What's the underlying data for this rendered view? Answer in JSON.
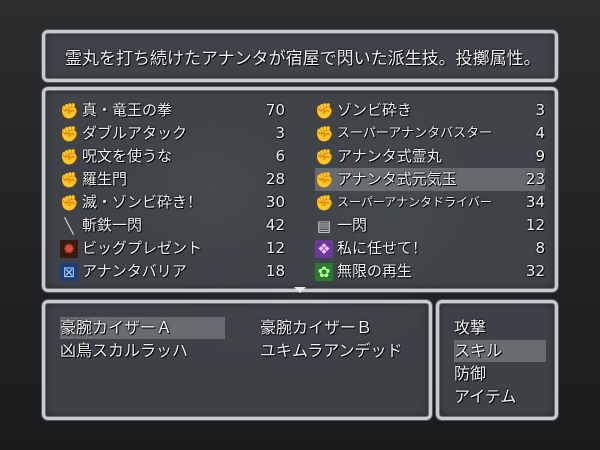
{
  "help": {
    "text": "霊丸を打ち続けたアナンタが宿屋で閃いた派生技。投擲属性。"
  },
  "skills": {
    "left": [
      {
        "icon": "fist-icon",
        "name": "真・竜王の拳",
        "cost": "70"
      },
      {
        "icon": "fist-icon",
        "name": "ダブルアタック",
        "cost": "3"
      },
      {
        "icon": "fist-icon",
        "name": "呪文を使うな",
        "cost": "6"
      },
      {
        "icon": "fist-icon",
        "name": "羅生門",
        "cost": "28"
      },
      {
        "icon": "fist-icon",
        "name": "滅・ゾンビ砕き！",
        "cost": "30"
      },
      {
        "icon": "sword-icon",
        "name": "斬鉄一閃",
        "cost": "42"
      },
      {
        "icon": "present-icon",
        "name": "ビッグプレゼント",
        "cost": "12"
      },
      {
        "icon": "barrier-icon",
        "name": "アナンタバリア",
        "cost": "18"
      }
    ],
    "right": [
      {
        "icon": "fist-icon",
        "name": "ゾンビ砕き",
        "cost": "3"
      },
      {
        "icon": "fist-icon",
        "name": "スーパーアナンタバスター",
        "cost": "4"
      },
      {
        "icon": "fist-icon",
        "name": "アナンタ式霊丸",
        "cost": "9"
      },
      {
        "icon": "fist-icon",
        "name": "アナンタ式元気玉",
        "cost": "23"
      },
      {
        "icon": "fist-icon",
        "name": "スーパーアナンタドライバー",
        "cost": "34"
      },
      {
        "icon": "sword-scroll-icon",
        "name": "一閃",
        "cost": "12"
      },
      {
        "icon": "purple-rune-icon",
        "name": "私に任せて！",
        "cost": "8"
      },
      {
        "icon": "green-regen-icon",
        "name": "無限の再生",
        "cost": "32"
      }
    ],
    "selected": "アナンタ式元気玉"
  },
  "enemies": {
    "items": [
      "豪腕カイザーＡ",
      "豪腕カイザーＢ",
      "凶鳥スカルラッハ",
      "ユキムラアンデッド"
    ],
    "selected": "豪腕カイザーＡ"
  },
  "commands": {
    "items": [
      "攻撃",
      "スキル",
      "防御",
      "アイテム"
    ],
    "selected": "スキル"
  }
}
